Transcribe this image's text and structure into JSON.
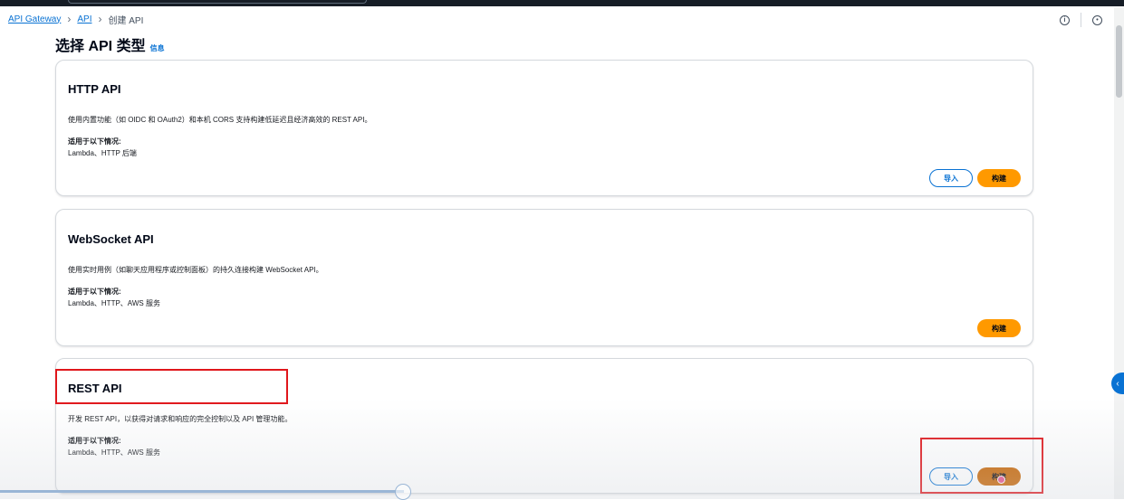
{
  "breadcrumb": {
    "items": [
      "API Gateway",
      "API"
    ],
    "current": "创建 API"
  },
  "header": {
    "info_icon": "info-circle-icon",
    "settings_icon": "gear-circle-icon"
  },
  "page": {
    "title": "选择 API 类型",
    "info_link": "信息"
  },
  "cards": [
    {
      "title": "HTTP API",
      "description": "使用内置功能（如 OIDC 和 OAuth2）和本机 CORS 支持构建低延迟且经济高效的 REST API。",
      "use_title": "适用于以下情况:",
      "use_value": "Lambda、HTTP 后端",
      "import_label": "导入",
      "build_label": "构建"
    },
    {
      "title": "WebSocket API",
      "description": "使用实时用例（如聊天应用程序或控制面板）的持久连接构建 WebSocket API。",
      "use_title": "适用于以下情况:",
      "use_value": "Lambda、HTTP、AWS 服务",
      "build_label": "构建"
    },
    {
      "title": "REST API",
      "description": "开发 REST API，以获得对请求和响应的完全控制以及 API 管理功能。",
      "use_title": "适用于以下情况:",
      "use_value": "Lambda、HTTP、AWS 服务",
      "import_label": "导入",
      "build_label": "构建"
    }
  ],
  "colors": {
    "link": "#0972d3",
    "primary_button": "#ff9900",
    "highlight": "#e0161b"
  },
  "video_progress": 0.36
}
